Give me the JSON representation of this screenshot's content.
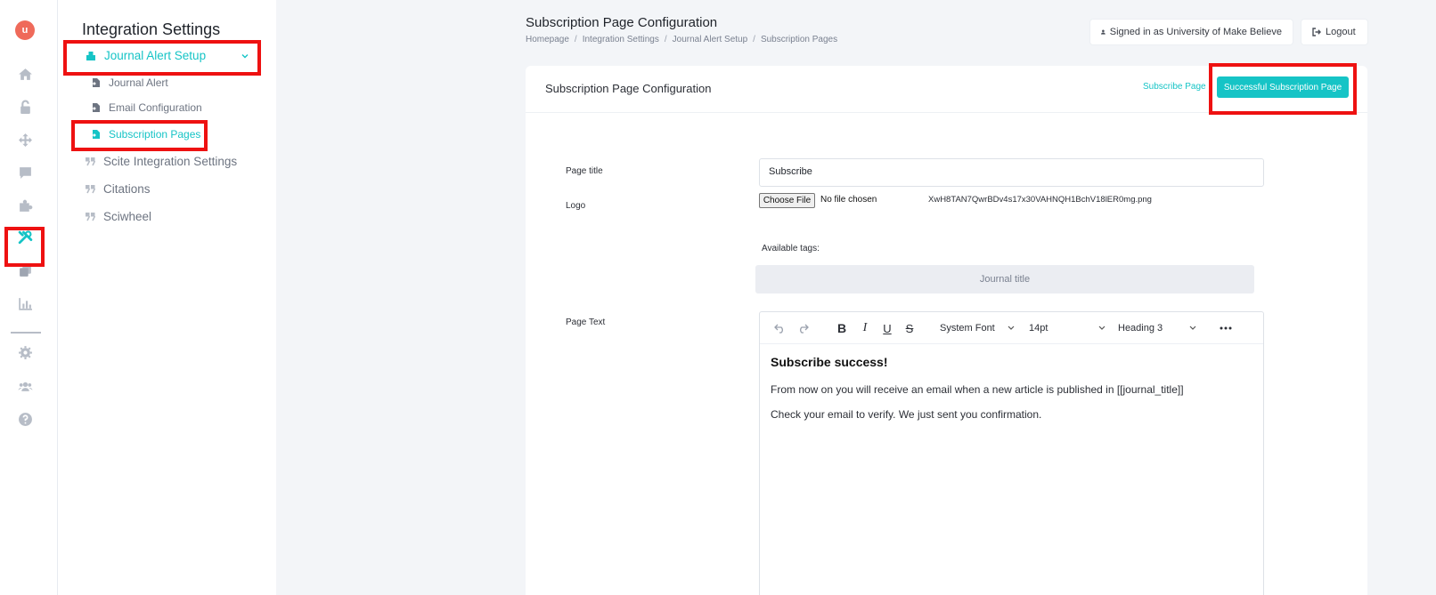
{
  "rail": {
    "logo": "u",
    "icons": [
      "home-icon",
      "unlock-icon",
      "move-arrows-icon",
      "comment-icon",
      "puzzle-icon",
      "tools-icon",
      "copy-icon",
      "bar-chart-icon",
      "gear-icon",
      "users-icon",
      "help-icon"
    ]
  },
  "sidebar": {
    "title": "Integration Settings",
    "parent": "Journal Alert Setup",
    "sub_items": [
      "Journal Alert",
      "Email Configuration",
      "Subscription Pages"
    ],
    "items": [
      "Scite Integration Settings",
      "Citations",
      "Sciwheel"
    ]
  },
  "header": {
    "title": "Subscription Page Configuration",
    "breadcrumb": [
      "Homepage",
      "Integration Settings",
      "Journal Alert Setup",
      "Subscription Pages"
    ],
    "signed_in": "Signed in as University of Make Believe",
    "logout": "Logout"
  },
  "card": {
    "title": "Subscription Page Configuration",
    "subscribe_link": "Subscribe Page",
    "success_button": "Successful Subscription Page",
    "page_title_label": "Page title",
    "page_title_value": "Subscribe",
    "logo_label": "Logo",
    "file_button": "Choose File",
    "file_status": "No file chosen",
    "file_name": "XwH8TAN7QwrBDv4s17x30VAHNQH1BchV18lER0mg.png",
    "tags_label": "Available tags:",
    "tag": "Journal title",
    "page_text_label": "Page Text"
  },
  "editor": {
    "font": "System Font",
    "size": "14pt",
    "block": "Heading 3",
    "heading": "Subscribe success!",
    "line1": "From now on you will receive an email when a new article is published in [[journal_title]]",
    "line2": "Check your email to verify. We just sent you confirmation."
  },
  "colors": {
    "accent": "#16c4c6",
    "highlight": "#ee1111",
    "logo": "#ef6a5a"
  }
}
